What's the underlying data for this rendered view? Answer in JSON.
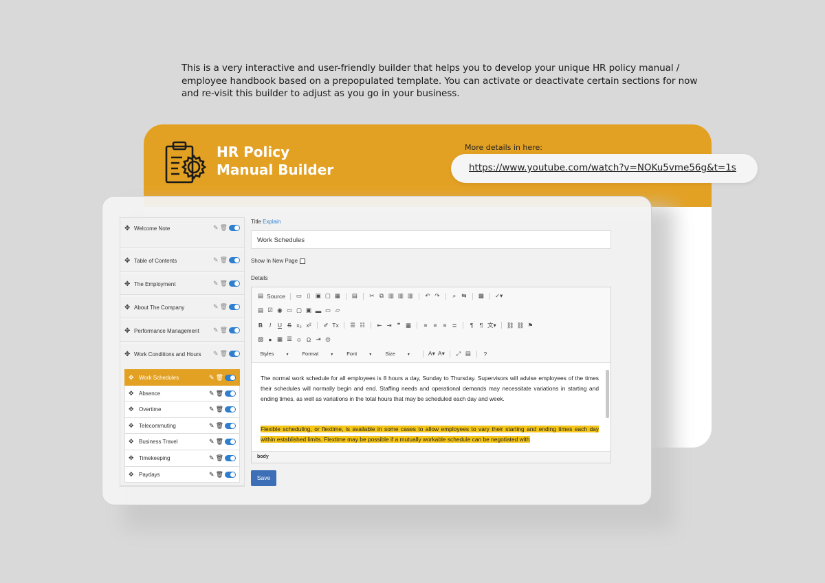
{
  "intro": "This is a very interactive and user-friendly builder that helps you to develop your unique HR policy manual / employee handbook based on a prepopulated template. You can activate or deactivate certain sections for now and re-visit this builder to adjust as you go in your business.",
  "header": {
    "title_line1": "HR Policy",
    "title_line2": "Manual Builder",
    "details_label": "More details in here:",
    "url": "https://www.youtube.com/watch?v=NOKu5vme56g&t=1s",
    "accent_color": "#e3a123",
    "icon": "clipboard-gear-icon"
  },
  "sidebar": {
    "items": [
      {
        "label": "Welcome Note"
      },
      {
        "label": "Table of Contents"
      },
      {
        "label": "The Employment"
      },
      {
        "label": "About The Company"
      },
      {
        "label": "Performance Management"
      },
      {
        "label": "Work Conditions and Hours"
      }
    ],
    "subitems": [
      {
        "label": "Work Schedules",
        "active": true
      },
      {
        "label": "Absence"
      },
      {
        "label": "Overtime"
      },
      {
        "label": "Telecommuting"
      },
      {
        "label": "Business Travel"
      },
      {
        "label": "Timekeeping"
      },
      {
        "label": "Paydays"
      }
    ]
  },
  "form": {
    "title_label": "Title",
    "explain_link": "Explain",
    "title_value": "Work Schedules",
    "new_page_label": "Show In New Page",
    "details_label": "Details",
    "toolbar": {
      "source_label": "Source",
      "styles": "Styles",
      "format": "Format",
      "font": "Font",
      "size": "Size"
    },
    "content_p1": "The normal work schedule for all employees is 8 hours a day, Sunday to Thursday.  Supervisors will advise employees of the times their schedules will normally begin and end. Staffing needs and operational demands may necessitate variations in starting and ending times, as well as variations in the total hours that may be scheduled each day and week.",
    "content_p2": "Flexible scheduling, or flextime, is available in some cases to allow employees to vary their starting and ending times each day within established limits. Flextime may be possible if a mutually workable schedule can be negotiated with",
    "element_path": "body",
    "save_label": "Save",
    "save_color": "#3d6fb6",
    "highlight_color": "#f5c518"
  }
}
